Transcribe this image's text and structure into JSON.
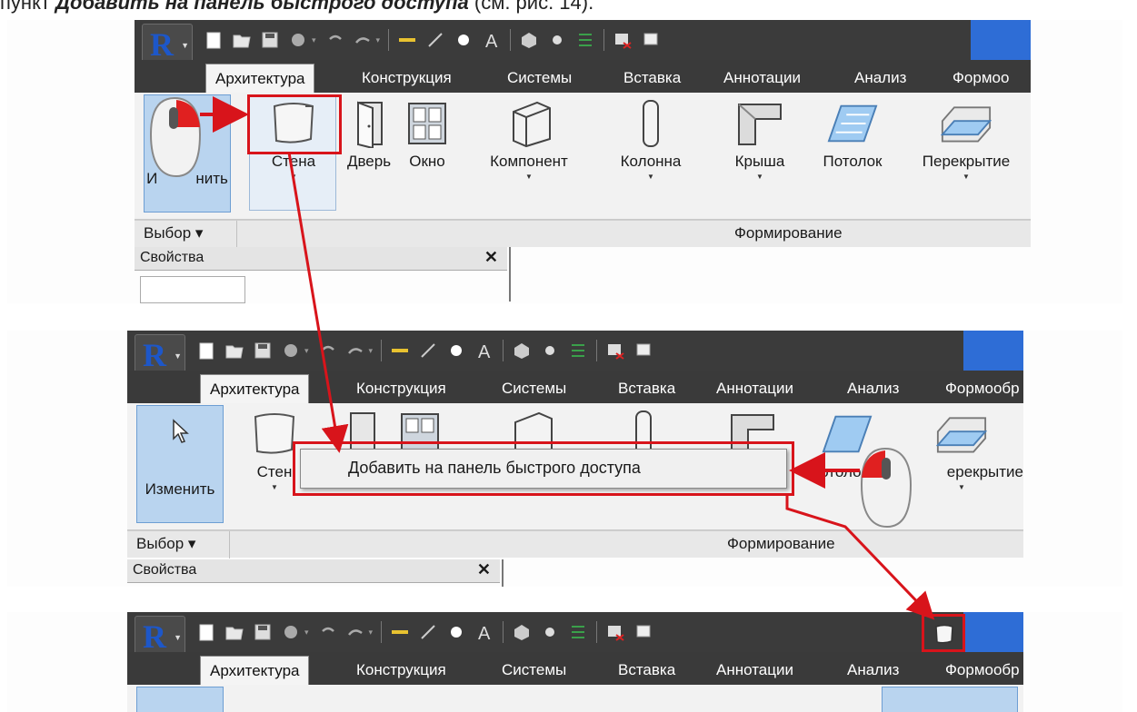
{
  "caption": {
    "prefix": "пункт ",
    "bold": "Добавить на панель быстрого доступа",
    "suffix": " (см. рис. 14)."
  },
  "app_button": {
    "logo": "R"
  },
  "qat_icons": [
    "new-icon",
    "open-icon",
    "save-icon",
    "sync-icon",
    "undo-icon",
    "redo-icon",
    "measure-icon",
    "dimension-icon",
    "tag-icon",
    "text-icon",
    "3d-view-icon",
    "section-icon",
    "thin-lines-icon",
    "close-windows-icon",
    "switch-windows-icon"
  ],
  "tabs": [
    "Архитектура",
    "Конструкция",
    "Системы",
    "Вставка",
    "Аннотации",
    "Анализ",
    "Формоо"
  ],
  "tabs_p2": [
    "Архитектура",
    "Конструкция",
    "Системы",
    "Вставка",
    "Аннотации",
    "Анализ",
    "Формообр"
  ],
  "tools": {
    "modify": "Изменить",
    "modify_cut": "И",
    "modify_tail": "нить",
    "wall": "Стена",
    "wall_cut": "Стен",
    "door": "Дверь",
    "window": "Окно",
    "component": "Компонент",
    "column": "Колонна",
    "roof": "Крыша",
    "ceiling": "Потолок",
    "ceiling_cut": "Потоло",
    "floor": "Перекрытие",
    "floor_cut": "ерекрытие"
  },
  "panel_bar": {
    "select": "Выбор ▾",
    "build": "Формирование"
  },
  "properties": {
    "title": "Свойства",
    "close": "✕"
  },
  "context_menu": {
    "item": "Добавить на панель быстрого доступа"
  },
  "colors": {
    "highlight": "#d8141b",
    "accent": "#2e6dd6",
    "ribbon_dark": "#3a3a3a"
  }
}
